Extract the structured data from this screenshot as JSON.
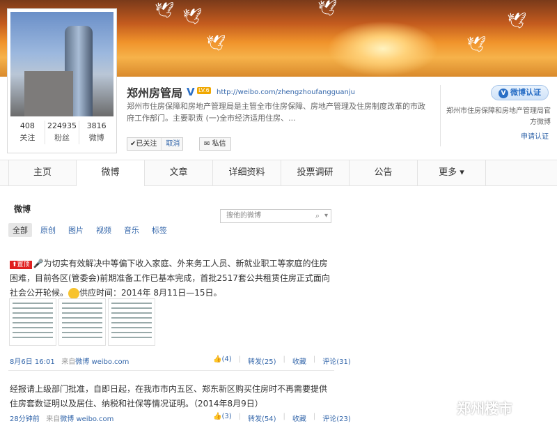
{
  "profile": {
    "name": "郑州房管局",
    "level": "LV.6",
    "url": "http://weibo.com/zhengzhoufangguanju",
    "description": "郑州市住房保障和房地产管理局是主管全市住房保障、房地产管理及住房制度改革的市政府工作部门。主要职责 (一)全市经济适用住房、...",
    "stats": [
      {
        "value": "408",
        "label": "关注"
      },
      {
        "value": "224935",
        "label": "粉丝"
      },
      {
        "value": "3816",
        "label": "微博"
      }
    ],
    "followed_label": "✔已关注",
    "cancel_label": "取消",
    "message_label": "私信"
  },
  "verify": {
    "button_label": "微博认证",
    "description": "郑州市住房保障和房地产管理局官方微博",
    "apply_label": "申请认证"
  },
  "nav": {
    "tabs": [
      "主页",
      "微博",
      "文章",
      "详细资料",
      "投票调研",
      "公告",
      "更多 ▾"
    ]
  },
  "feed": {
    "title": "微博",
    "search_placeholder": "搜他的微博",
    "filters": [
      "全部",
      "原创",
      "图片",
      "视频",
      "音乐",
      "标签"
    ],
    "posts": [
      {
        "pin_label": "置顶",
        "text": "为切实有效解决中等偏下收入家庭、外来务工人员、新就业职工等家庭的住房困难，目前各区(管委会)前期准备工作已基本完成，首批2517套公共租赁住房正式面向社会公开轮候。",
        "text_tail": "供应时间：2014年 8月11日—15日。",
        "time": "8月6日 16:01",
        "source_prefix": "来自",
        "source": "微博 weibo.com",
        "likes": "(4)",
        "repost": "转发(25)",
        "fav": "收藏",
        "comment": "评论(31)"
      },
      {
        "text": "经报请上级部门批准，自即日起，在我市市内五区、郑东新区购买住房时不再需要提供住房套数证明以及居住、纳税和社保等情况证明。（2014年8月9日）",
        "time": "28分钟前",
        "source_prefix": "来自",
        "source": "微博 weibo.com",
        "likes": "(3)",
        "repost": "转发(54)",
        "fav": "收藏",
        "comment": "评论(23)"
      }
    ]
  },
  "watermark": "郑州楼市",
  "colors": {
    "link": "#3366aa",
    "pin": "#e02020",
    "verify": "#2a6fc6"
  }
}
